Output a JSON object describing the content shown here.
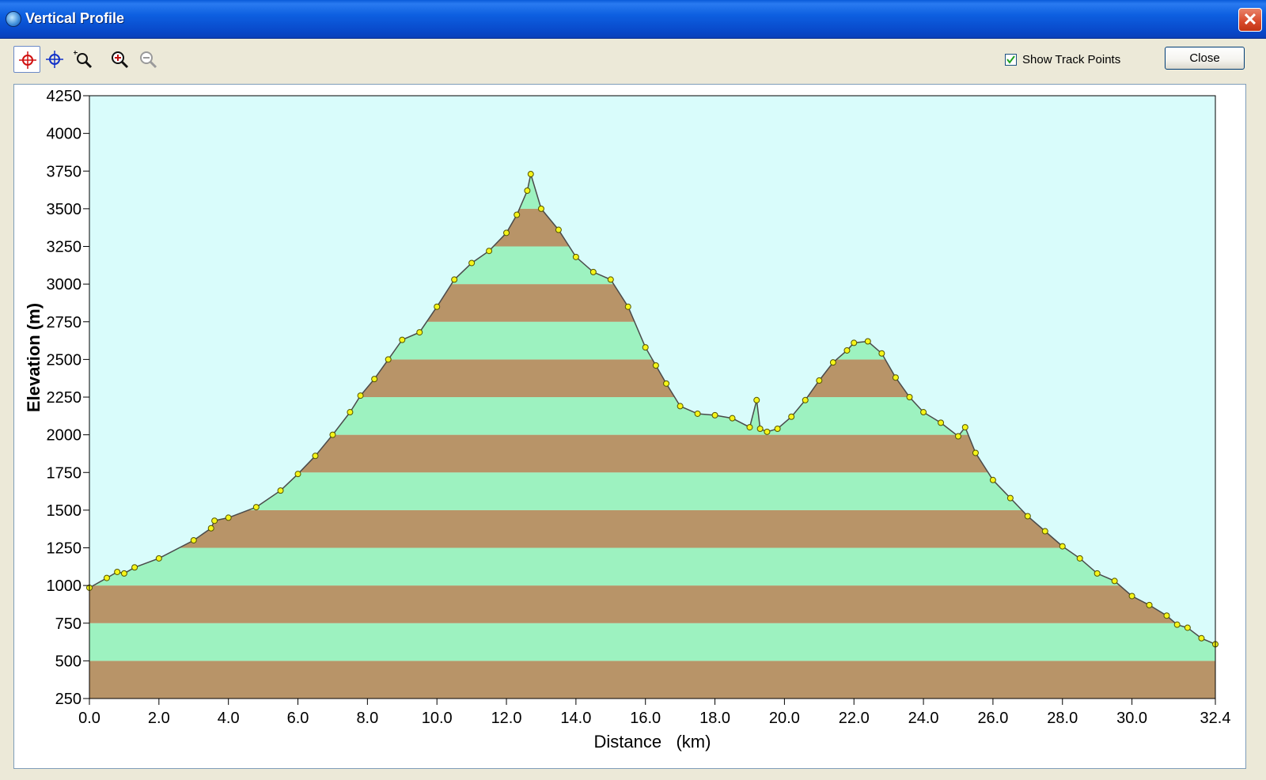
{
  "window": {
    "title": "Vertical Profile",
    "close_glyph": "✕"
  },
  "toolbar": {
    "tools": [
      {
        "name": "select-point-tool",
        "icon": "crosshair-red-icon"
      },
      {
        "name": "move-point-tool",
        "icon": "crosshair-blue-icon"
      },
      {
        "name": "zoom-area-tool",
        "icon": "zoom-area-icon"
      },
      {
        "name": "zoom-in-tool",
        "icon": "zoom-in-icon"
      },
      {
        "name": "zoom-out-tool",
        "icon": "zoom-out-icon"
      }
    ],
    "show_track_points_label": "Show Track Points",
    "show_track_points_checked": true,
    "close_label": "Close"
  },
  "chart_data": {
    "type": "area",
    "xlabel": "Distance   (km)",
    "ylabel": "Elevation (m)",
    "xlim": [
      0,
      32.4
    ],
    "ylim": [
      250,
      4250
    ],
    "x_ticks": [
      "0.0",
      "2.0",
      "4.0",
      "6.0",
      "8.0",
      "10.0",
      "12.0",
      "14.0",
      "16.0",
      "18.0",
      "20.0",
      "22.0",
      "24.0",
      "26.0",
      "28.0",
      "30.0",
      "32.4"
    ],
    "x_tick_values": [
      0,
      2,
      4,
      6,
      8,
      10,
      12,
      14,
      16,
      18,
      20,
      22,
      24,
      26,
      28,
      30,
      32.4
    ],
    "y_ticks": [
      250,
      500,
      750,
      1000,
      1250,
      1500,
      1750,
      2000,
      2250,
      2500,
      2750,
      3000,
      3250,
      3500,
      3750,
      4000,
      4250
    ],
    "band_step": 250,
    "colors": {
      "background": "#d9fcfb",
      "band_light": "#9df2c0",
      "band_dark": "#b89468",
      "line": "#4a4a4a",
      "point_fill": "#f5f51a",
      "point_stroke": "#555500"
    },
    "x": [
      0.0,
      0.5,
      0.8,
      1.0,
      1.3,
      2.0,
      3.0,
      3.5,
      3.6,
      4.0,
      4.8,
      5.5,
      6.0,
      6.5,
      7.0,
      7.5,
      7.8,
      8.2,
      8.6,
      9.0,
      9.5,
      10.0,
      10.5,
      11.0,
      11.5,
      12.0,
      12.3,
      12.6,
      12.7,
      13.0,
      13.5,
      14.0,
      14.5,
      15.0,
      15.5,
      16.0,
      16.3,
      16.6,
      17.0,
      17.5,
      18.0,
      18.5,
      19.0,
      19.2,
      19.3,
      19.5,
      19.8,
      20.2,
      20.6,
      21.0,
      21.4,
      21.8,
      22.0,
      22.4,
      22.8,
      23.2,
      23.6,
      24.0,
      24.5,
      25.0,
      25.2,
      25.5,
      26.0,
      26.5,
      27.0,
      27.5,
      28.0,
      28.5,
      29.0,
      29.5,
      30.0,
      30.5,
      31.0,
      31.3,
      31.6,
      32.0,
      32.4
    ],
    "elevation": [
      985,
      1050,
      1090,
      1080,
      1120,
      1180,
      1300,
      1380,
      1430,
      1450,
      1520,
      1630,
      1740,
      1860,
      2000,
      2150,
      2260,
      2370,
      2500,
      2630,
      2680,
      2850,
      3030,
      3140,
      3220,
      3340,
      3460,
      3620,
      3730,
      3500,
      3360,
      3180,
      3080,
      3030,
      2850,
      2580,
      2460,
      2340,
      2190,
      2140,
      2130,
      2110,
      2050,
      2230,
      2040,
      2020,
      2040,
      2120,
      2230,
      2360,
      2480,
      2560,
      2610,
      2620,
      2540,
      2380,
      2250,
      2150,
      2080,
      1990,
      2050,
      1880,
      1700,
      1580,
      1460,
      1360,
      1260,
      1180,
      1080,
      1030,
      930,
      870,
      800,
      740,
      720,
      650,
      610
    ]
  }
}
